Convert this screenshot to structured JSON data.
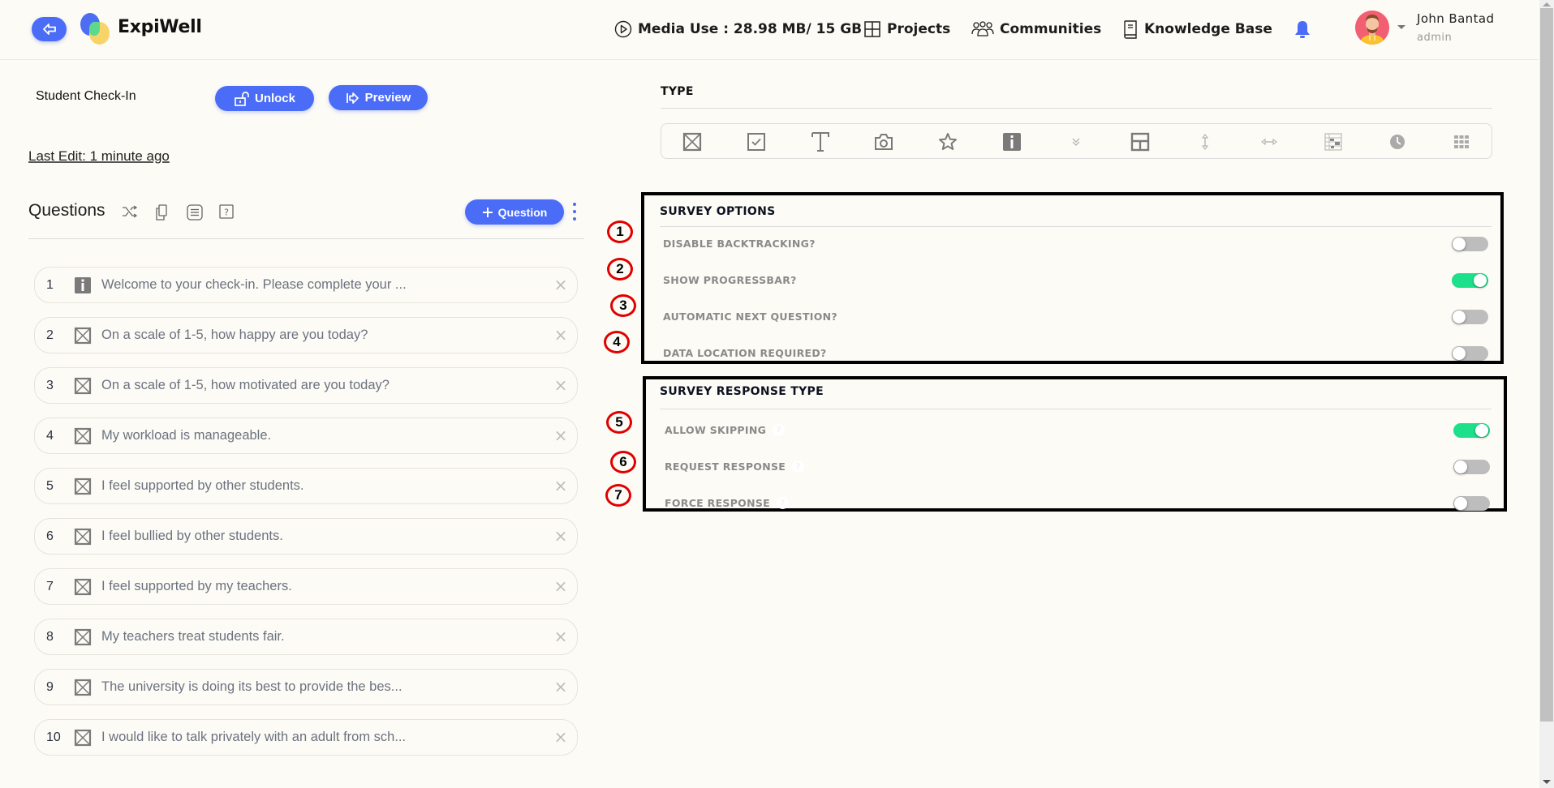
{
  "header": {
    "brand": "ExpiWell",
    "media_use": "Media Use : 28.98 MB/ 15 GB",
    "nav": [
      {
        "label": "Projects",
        "icon": "grid-icon"
      },
      {
        "label": "Communities",
        "icon": "users-icon"
      },
      {
        "label": "Knowledge Base",
        "icon": "book-icon"
      }
    ],
    "user": {
      "name": "John Bantad",
      "role": "admin"
    }
  },
  "survey": {
    "title": "Student Check-In",
    "unlock_label": "Unlock",
    "preview_label": "Preview",
    "last_edit": "Last Edit: 1 minute ago"
  },
  "questions": {
    "heading": "Questions",
    "add_label": "Question",
    "items": [
      {
        "num": "1",
        "type": "info",
        "text": "Welcome to your check-in. Please complete your ..."
      },
      {
        "num": "2",
        "type": "multiple-choice",
        "text": "On a scale of 1-5, how happy are you today?"
      },
      {
        "num": "3",
        "type": "multiple-choice",
        "text": "On a scale of 1-5, how motivated are you today?"
      },
      {
        "num": "4",
        "type": "multiple-choice",
        "text": "My workload is manageable."
      },
      {
        "num": "5",
        "type": "multiple-choice",
        "text": "I feel supported by other students."
      },
      {
        "num": "6",
        "type": "multiple-choice",
        "text": "I feel bullied by other students."
      },
      {
        "num": "7",
        "type": "multiple-choice",
        "text": "I feel supported by my teachers."
      },
      {
        "num": "8",
        "type": "multiple-choice",
        "text": "My teachers treat students fair."
      },
      {
        "num": "9",
        "type": "multiple-choice",
        "text": "The university is doing its best to provide the bes..."
      },
      {
        "num": "10",
        "type": "multiple-choice",
        "text": "I would like to talk privately with an adult from sch..."
      }
    ]
  },
  "type_panel": {
    "label": "TYPE",
    "types": [
      "single-choice",
      "multiple-choice",
      "text",
      "photo",
      "rating",
      "info",
      "dropdown",
      "layout",
      "vertical-slider",
      "horizontal-slider",
      "matrix",
      "time",
      "grid"
    ],
    "selected": "info"
  },
  "survey_options": {
    "title": "SURVEY OPTIONS",
    "items": [
      {
        "badge": "1",
        "label": "DISABLE BACKTRACKING?",
        "enabled": false
      },
      {
        "badge": "2",
        "label": "SHOW PROGRESSBAR?",
        "enabled": true
      },
      {
        "badge": "3",
        "label": "AUTOMATIC NEXT QUESTION?",
        "enabled": false
      },
      {
        "badge": "4",
        "label": "DATA LOCATION REQUIRED?",
        "enabled": false
      }
    ]
  },
  "response_type": {
    "title": "SURVEY RESPONSE TYPE",
    "items": [
      {
        "badge": "5",
        "label": "ALLOW SKIPPING",
        "enabled": true
      },
      {
        "badge": "6",
        "label": "REQUEST RESPONSE",
        "enabled": false
      },
      {
        "badge": "7",
        "label": "FORCE RESPONSE",
        "enabled": false
      }
    ]
  },
  "colors": {
    "accent": "#4a6cf7",
    "toggle_on": "#1de08a",
    "toggle_off": "#bdbdbd",
    "background": "#fdfbf5",
    "annotation": "#e00000"
  }
}
